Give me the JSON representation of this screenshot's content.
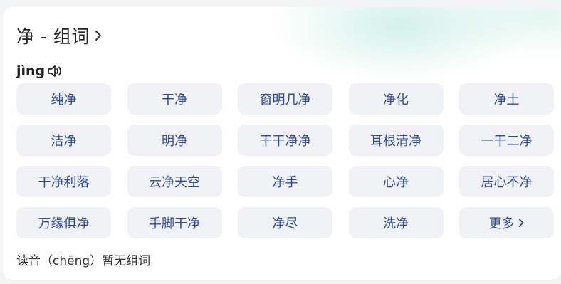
{
  "header": {
    "title": "净 - 组词",
    "pinyin": "jìng"
  },
  "words": [
    "纯净",
    "干净",
    "窗明几净",
    "净化",
    "净土",
    "洁净",
    "明净",
    "干干净净",
    "耳根清净",
    "一干二净",
    "干净利落",
    "云净天空",
    "净手",
    "心净",
    "居心不净",
    "万缘俱净",
    "手脚干净",
    "净尽",
    "洗净"
  ],
  "more_label": "更多",
  "footer": {
    "note": "读音（chēng）暂无组词"
  },
  "colors": {
    "word_text": "#2b4aa0",
    "word_bg": "#f1f2f5",
    "accent_gradient": "#c4ece2"
  },
  "icons": {
    "title_chevron": "chevron-right-icon",
    "speaker": "speaker-icon",
    "more_chevron": "chevron-right-icon"
  }
}
